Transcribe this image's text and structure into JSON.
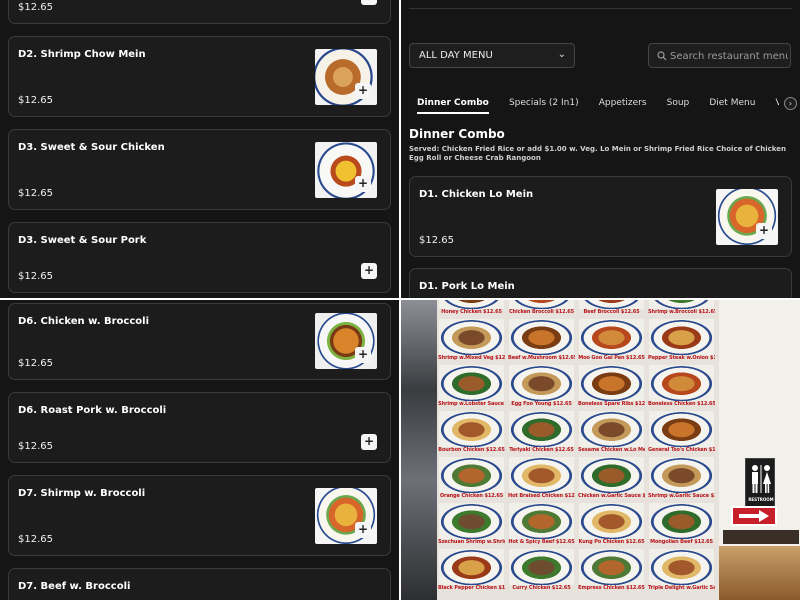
{
  "menu_list_top": {
    "partial_price": "$12.65",
    "items": [
      {
        "name": "D2. Shrimp Chow Mein",
        "price": "$12.65"
      },
      {
        "name": "D3. Sweet & Sour Chicken",
        "price": "$12.65"
      },
      {
        "name": "D3. Sweet & Sour Pork",
        "price": "$12.65"
      }
    ]
  },
  "menu_header": {
    "menu_select": {
      "selected": "ALL DAY MENU"
    },
    "search": {
      "placeholder": "Search restaurant menu"
    },
    "tabs": [
      {
        "label": "Dinner Combo",
        "active": true
      },
      {
        "label": "Specials (2 In1)"
      },
      {
        "label": "Appetizers"
      },
      {
        "label": "Soup"
      },
      {
        "label": "Diet Menu"
      },
      {
        "label": "V"
      }
    ],
    "section": {
      "title": "Dinner Combo",
      "description": "Served: Chicken Fried Rice or add $1.00 w. Veg. Lo Mein or Shrimp Fried Rice Choice of Chicken Egg Roll or Cheese Crab Rangoon"
    },
    "items": [
      {
        "name": "D1. Chicken Lo Mein",
        "price": "$12.65"
      },
      {
        "name": "D1. Pork Lo Mein"
      }
    ]
  },
  "menu_list_bottom": {
    "items": [
      {
        "name": "D6. Chicken w. Broccoli",
        "price": "$12.65"
      },
      {
        "name": "D6. Roast Pork w. Broccoli",
        "price": "$12.65"
      },
      {
        "name": "D7. Shirmp w. Broccoli",
        "price": "$12.65"
      },
      {
        "name": "D7. Beef w. Broccoli"
      }
    ]
  },
  "photo_board": {
    "captions": [
      "Honey Chicken $12.65",
      "Chicken Broccoli $12.65",
      "Beef Broccoli $12.65",
      "Shrimp w.Broccoli $12.65",
      "Shrimp w.Mixed Veg $12.65",
      "Beef w.Mushroom $12.65",
      "Moo Goo Gai Pan $12.65",
      "Pepper Steak w.Onion $12.65",
      "Shrimp w.Lobster Sauce $12.65",
      "Egg Foo Young $12.65",
      "Boneless Spare Ribs $12.65",
      "Boneless Chicken $12.65",
      "Bourbon Chicken $12.65",
      "Teriyaki Chicken $12.65",
      "Sesame Chicken w.Lo Mein $14.65",
      "General Tso's Chicken $12.65",
      "Orange Chicken $12.65",
      "Hot Braised Chicken $12.65",
      "Chicken w.Garlic Sauce $12.65",
      "Shrimp w.Garlic Sauce $12.65",
      "Szechuan Shrimp w.Shrimp F.R $14.65",
      "Hot & Spicy Beef $12.65",
      "Kung Po Chicken $12.65",
      "Mongolian Beef $12.65",
      "Black Pepper Chicken $12.65",
      "Curry Chicken $12.65",
      "Empress Chicken $12.65",
      "Triple Delight w.Garlic Sauce $13.95"
    ],
    "restroom_sign": "RESTROOM"
  }
}
